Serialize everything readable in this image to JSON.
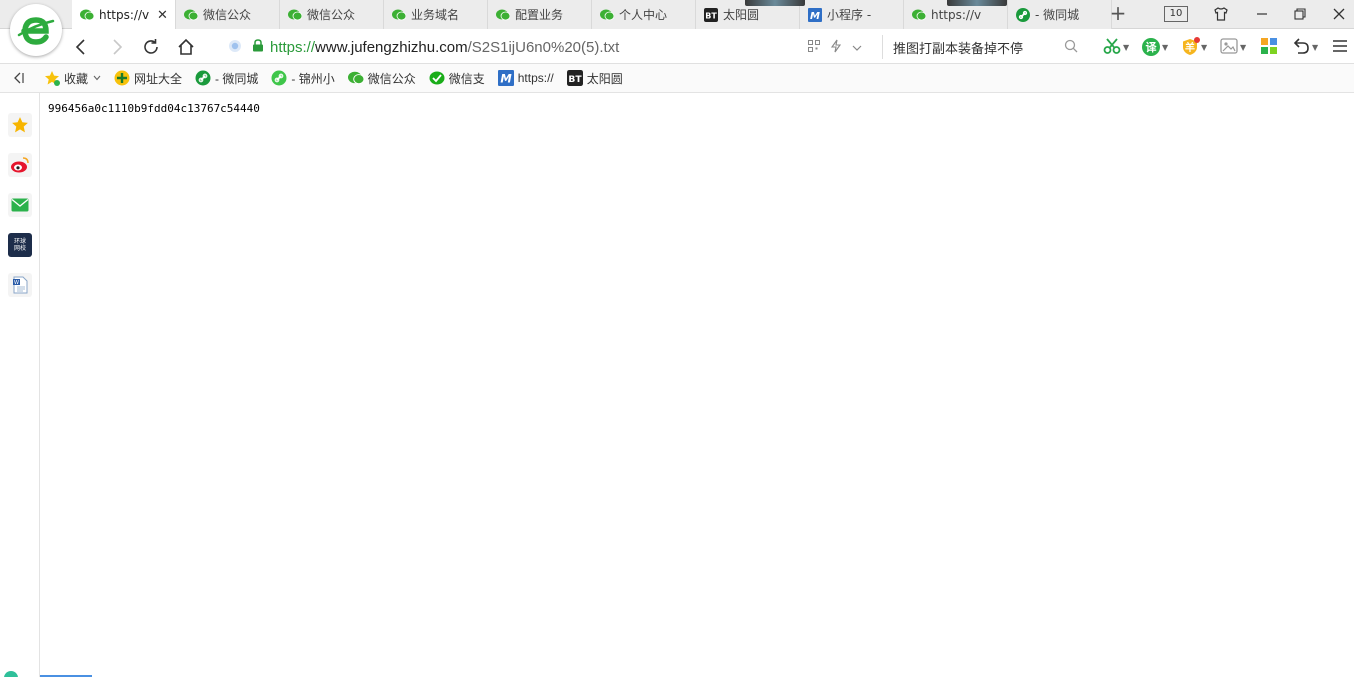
{
  "browser": {
    "accent": "#2a9a3a",
    "tabs": [
      {
        "label": "https://v",
        "icon": "wechat-icon",
        "active": true
      },
      {
        "label": "微信公众",
        "icon": "wechat-icon"
      },
      {
        "label": "微信公众",
        "icon": "wechat-icon"
      },
      {
        "label": "业务域名",
        "icon": "wechat-icon"
      },
      {
        "label": "配置业务",
        "icon": "wechat-icon"
      },
      {
        "label": "个人中心",
        "icon": "wechat-icon"
      },
      {
        "label": "太阳圆",
        "icon": "bt-icon"
      },
      {
        "label": "小程序 -",
        "icon": "m-icon"
      },
      {
        "label": "https://v",
        "icon": "wechat-icon"
      },
      {
        "label": "- 微同城",
        "icon": "link-icon"
      }
    ],
    "tab_count": "10",
    "address": {
      "scheme": "https://",
      "host": "www.jufengzhizhu.com",
      "path": "/S2S1ijU6n0%20(5).txt"
    },
    "search": {
      "text": "推图打副本装备掉不停"
    },
    "extensions": {
      "translate_label": "译",
      "wallet_label": "羊"
    }
  },
  "bookmarks": [
    {
      "label": "收藏",
      "icon": "star-icon",
      "dropdown": true
    },
    {
      "label": "网址大全",
      "icon": "plus-circle-icon"
    },
    {
      "label": "- 微同城",
      "icon": "link-icon"
    },
    {
      "label": "- 锦州小",
      "icon": "link-icon"
    },
    {
      "label": "微信公众",
      "icon": "wechat-icon"
    },
    {
      "label": "微信支",
      "icon": "wechat-pay-icon"
    },
    {
      "label": "https://",
      "icon": "m-icon"
    },
    {
      "label": "太阳圆",
      "icon": "bt-icon"
    }
  ],
  "sidebar": {
    "items": [
      {
        "name": "favorites",
        "icon": "star-icon"
      },
      {
        "name": "weibo",
        "icon": "weibo-icon"
      },
      {
        "name": "mail",
        "icon": "mail-icon"
      },
      {
        "name": "news",
        "icon": "news-icon",
        "label": "环球\n网校"
      },
      {
        "name": "word",
        "icon": "word-icon"
      }
    ]
  },
  "page": {
    "text": "996456a0c1110b9fdd04c13767c54440"
  }
}
